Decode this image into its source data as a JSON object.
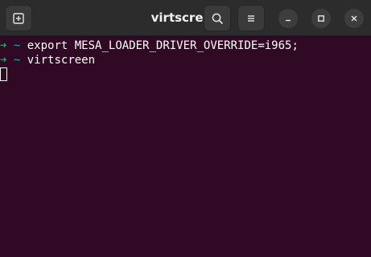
{
  "window": {
    "title": "virtscreen"
  },
  "titlebar": {
    "new_tab_icon": "new-tab-icon",
    "search_icon": "search-icon",
    "menu_icon": "hamburger-menu-icon",
    "minimize_icon": "minimize-icon",
    "maximize_icon": "maximize-icon",
    "close_icon": "close-icon"
  },
  "terminal": {
    "lines": [
      {
        "prompt_arrow": "➜",
        "prompt_dir": "~",
        "command": "export MESA_LOADER_DRIVER_OVERRIDE=i965;"
      },
      {
        "prompt_arrow": "➜",
        "prompt_dir": "~",
        "command": "virtscreen"
      }
    ]
  },
  "colors": {
    "background": "#300a24",
    "titlebar": "#2c2c2c",
    "prompt_arrow": "#26a269",
    "prompt_dir": "#2aa1b3",
    "text": "#ffffff"
  }
}
